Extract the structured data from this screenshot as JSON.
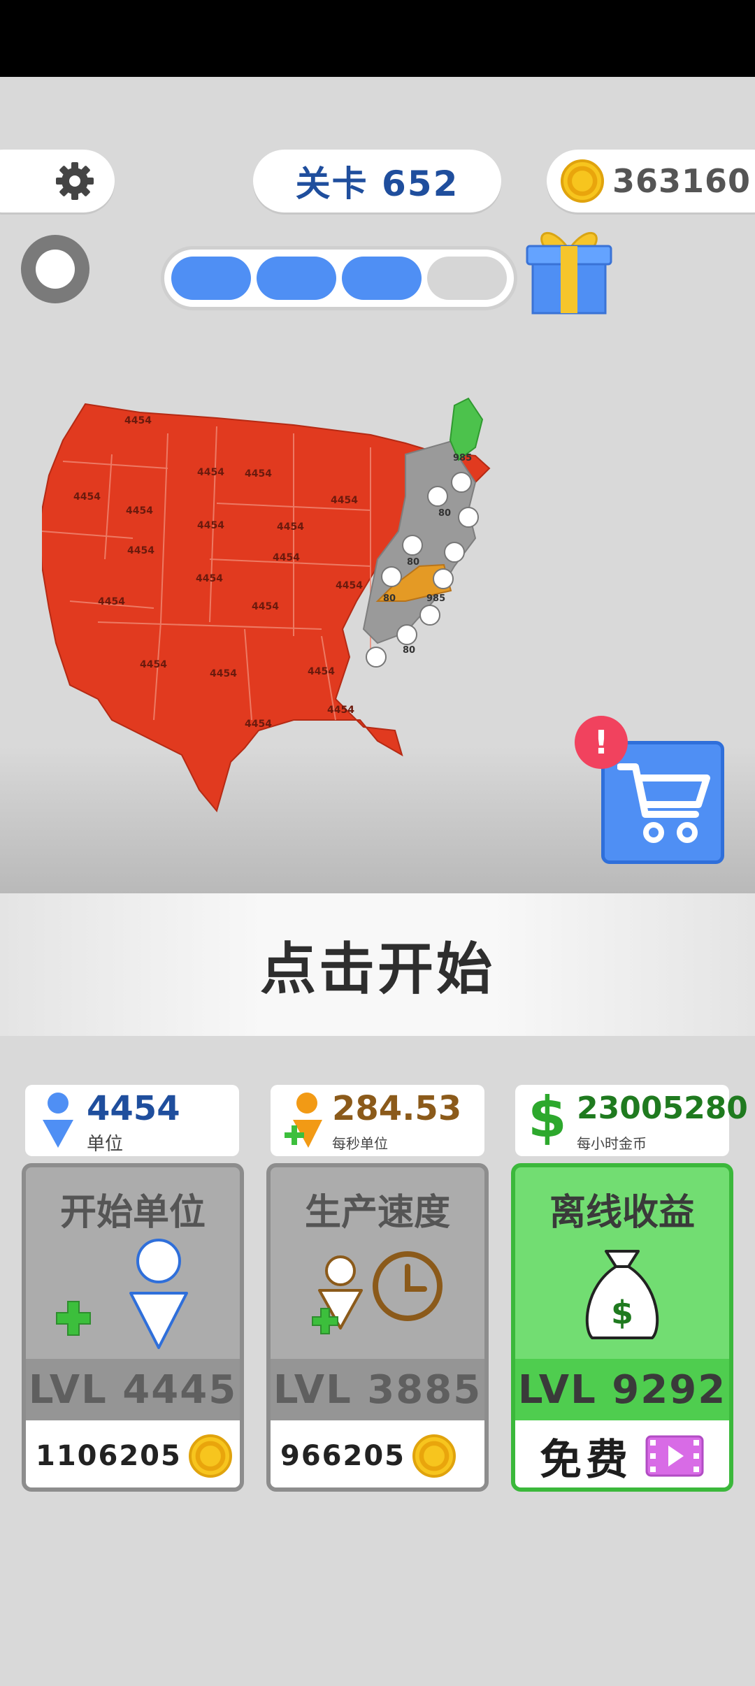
{
  "header": {
    "level_label": "关卡 652",
    "coins": "363160"
  },
  "progress": {
    "segments_filled": 3,
    "segments_total": 4
  },
  "map": {
    "red_unit_label": "4454",
    "gray_unit_label": "80",
    "special_label": "985"
  },
  "shop": {
    "badge": "!"
  },
  "tap_to_start": "点击开始",
  "stats": [
    {
      "value": "4454",
      "label": "单位"
    },
    {
      "value": "284.53",
      "label": "每秒单位"
    },
    {
      "value": "23005280",
      "label": "每小时金币"
    }
  ],
  "upgrades": [
    {
      "title": "开始单位",
      "level": "LVL 4445",
      "cost": "1106205"
    },
    {
      "title": "生产速度",
      "level": "LVL 3885",
      "cost": "966205"
    },
    {
      "title": "离线收益",
      "level": "LVL 9292",
      "cost": "免费"
    }
  ],
  "colors": {
    "player": "#e13a1f",
    "neutral": "#9a9a9a",
    "enemy_green": "#4cc24c",
    "enemy_orange": "#e49a25",
    "accent_blue": "#4f8ff4"
  }
}
